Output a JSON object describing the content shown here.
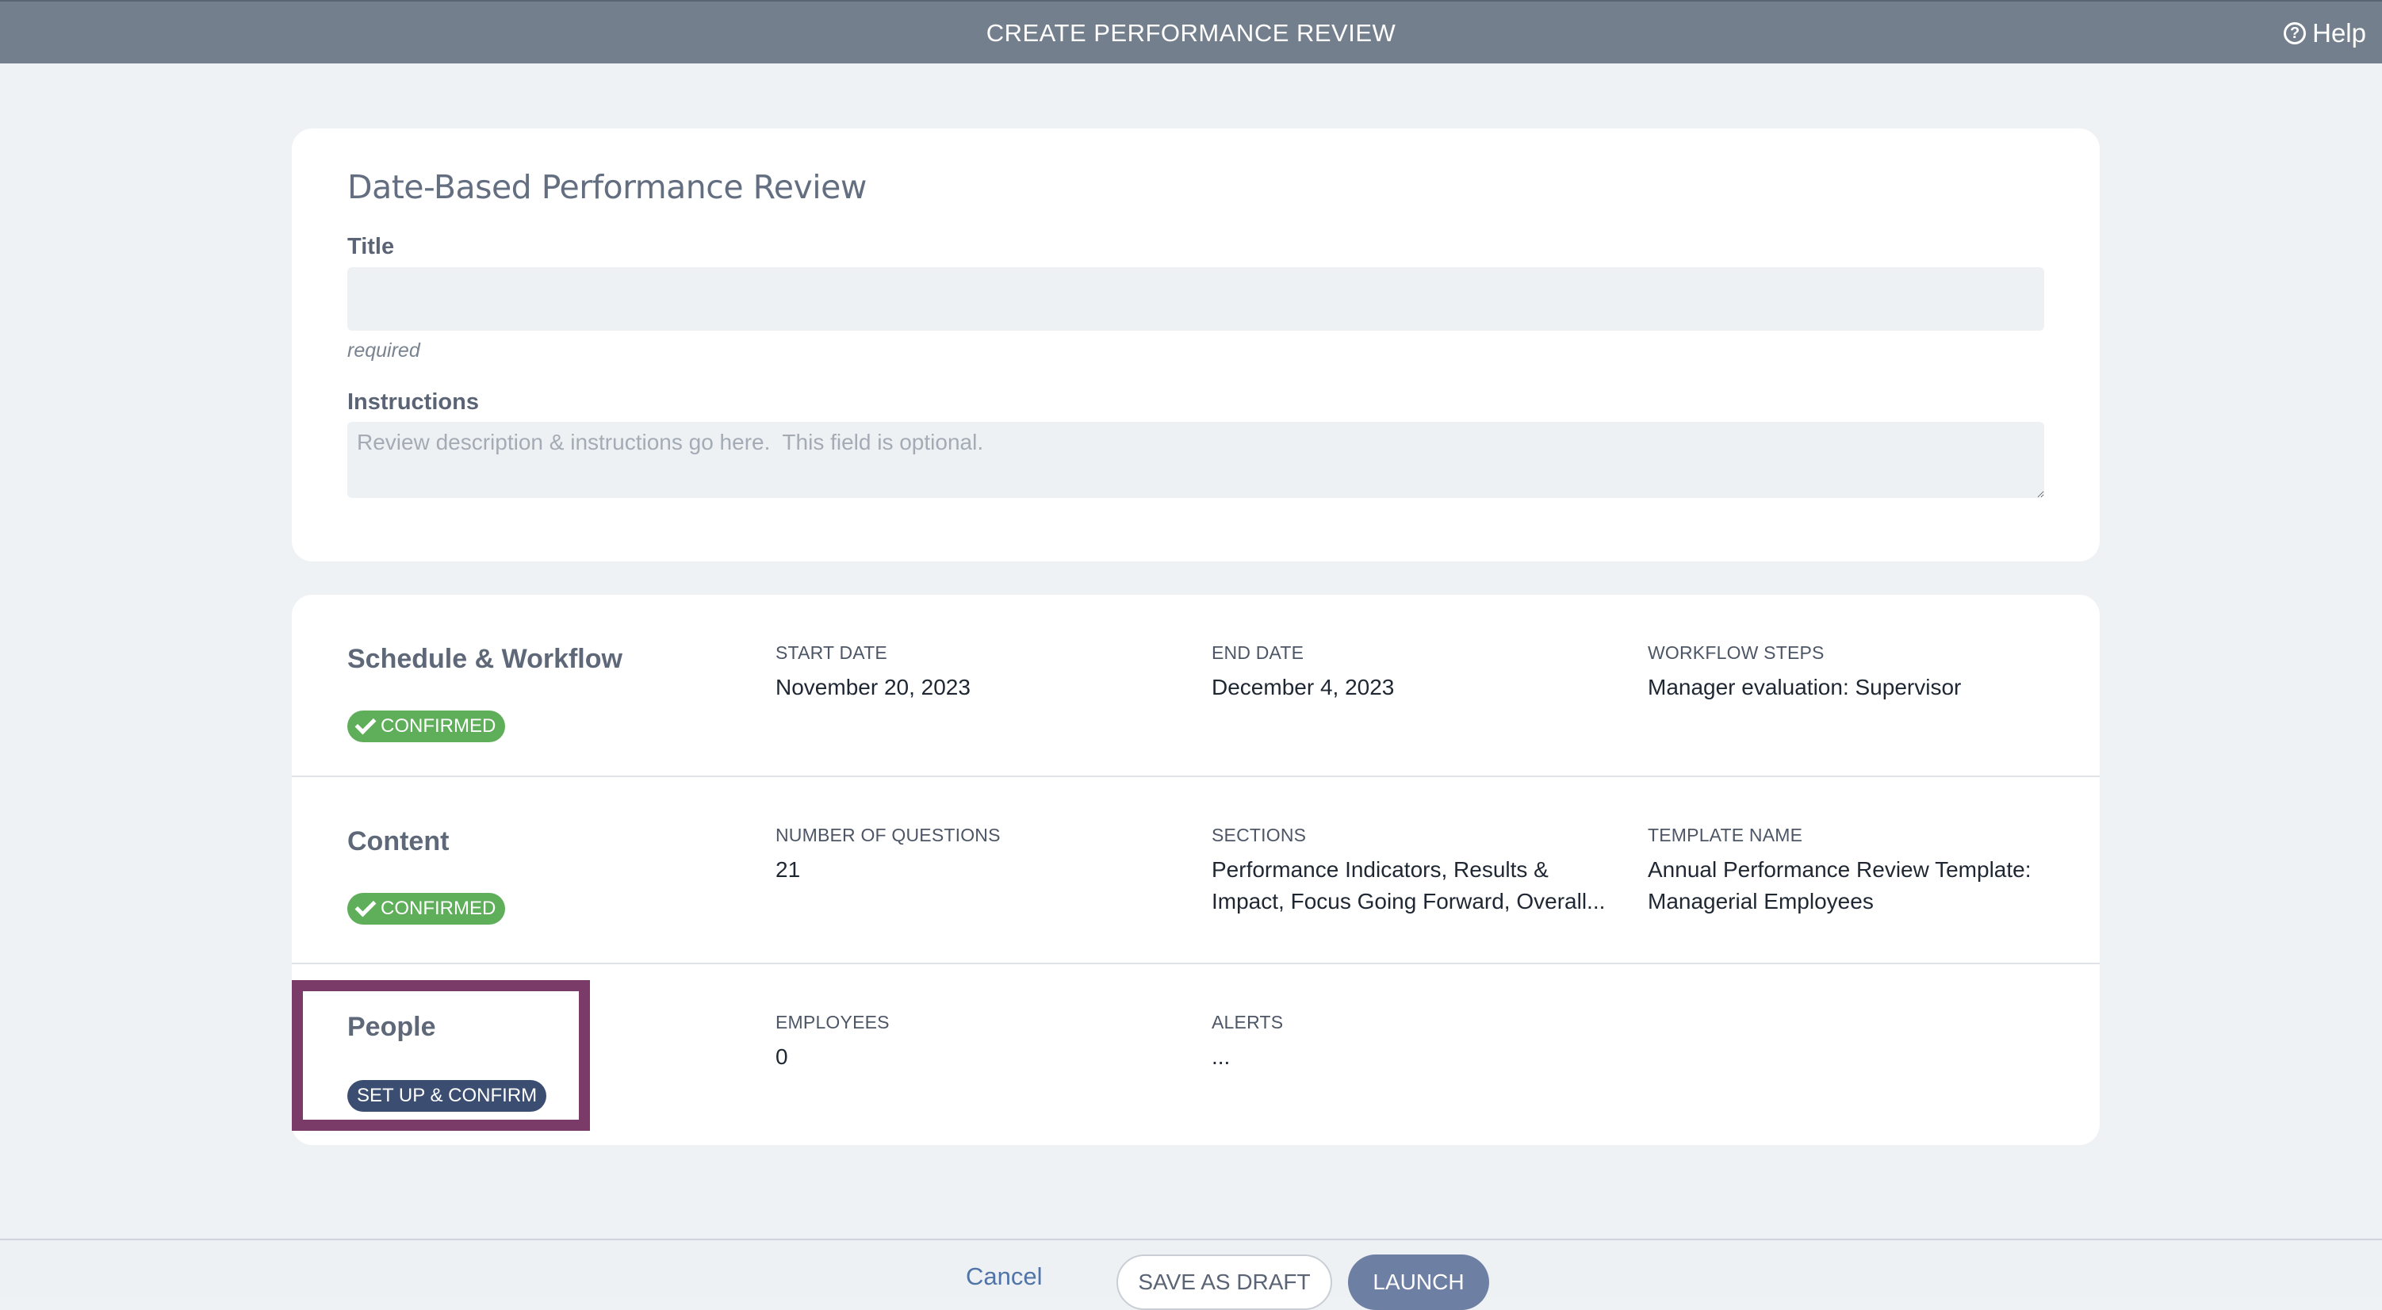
{
  "header": {
    "title": "CREATE PERFORMANCE REVIEW",
    "help_label": "Help",
    "help_icon": "question-circle-icon"
  },
  "form": {
    "heading": "Date-Based Performance Review",
    "title_label": "Title",
    "title_value": "",
    "title_note": "required",
    "instructions_label": "Instructions",
    "instructions_value": "",
    "instructions_placeholder": "Review description & instructions go here.  This field is optional."
  },
  "sections": {
    "schedule": {
      "title": "Schedule & Workflow",
      "badge": "CONFIRMED",
      "badge_icon": "checkmark-icon",
      "fields": [
        {
          "label": "START DATE",
          "value": "November 20, 2023"
        },
        {
          "label": "END DATE",
          "value": "December 4, 2023"
        },
        {
          "label": "WORKFLOW STEPS",
          "value": "Manager evaluation: Supervisor"
        }
      ]
    },
    "content": {
      "title": "Content",
      "badge": "CONFIRMED",
      "badge_icon": "checkmark-icon",
      "fields": [
        {
          "label": "NUMBER OF QUESTIONS",
          "value": "21"
        },
        {
          "label": "SECTIONS",
          "value": "Performance Indicators, Results & Impact, Focus Going Forward, Overall..."
        },
        {
          "label": "TEMPLATE NAME",
          "value": "Annual Performance Review Template: Managerial Employees"
        }
      ]
    },
    "people": {
      "title": "People",
      "badge": "SET UP & CONFIRM",
      "fields": [
        {
          "label": "EMPLOYEES",
          "value": "0"
        },
        {
          "label": "ALERTS",
          "value": "..."
        }
      ]
    }
  },
  "footer": {
    "cancel_label": "Cancel",
    "draft_label": "SAVE AS DRAFT",
    "launch_label": "LAUNCH"
  },
  "colors": {
    "header_bg": "#737f8c",
    "confirmed_green": "#5fae5a",
    "setup_navy": "#3b4d70",
    "highlight": "#7a3b69",
    "launch_bg": "#6e7fa4"
  }
}
